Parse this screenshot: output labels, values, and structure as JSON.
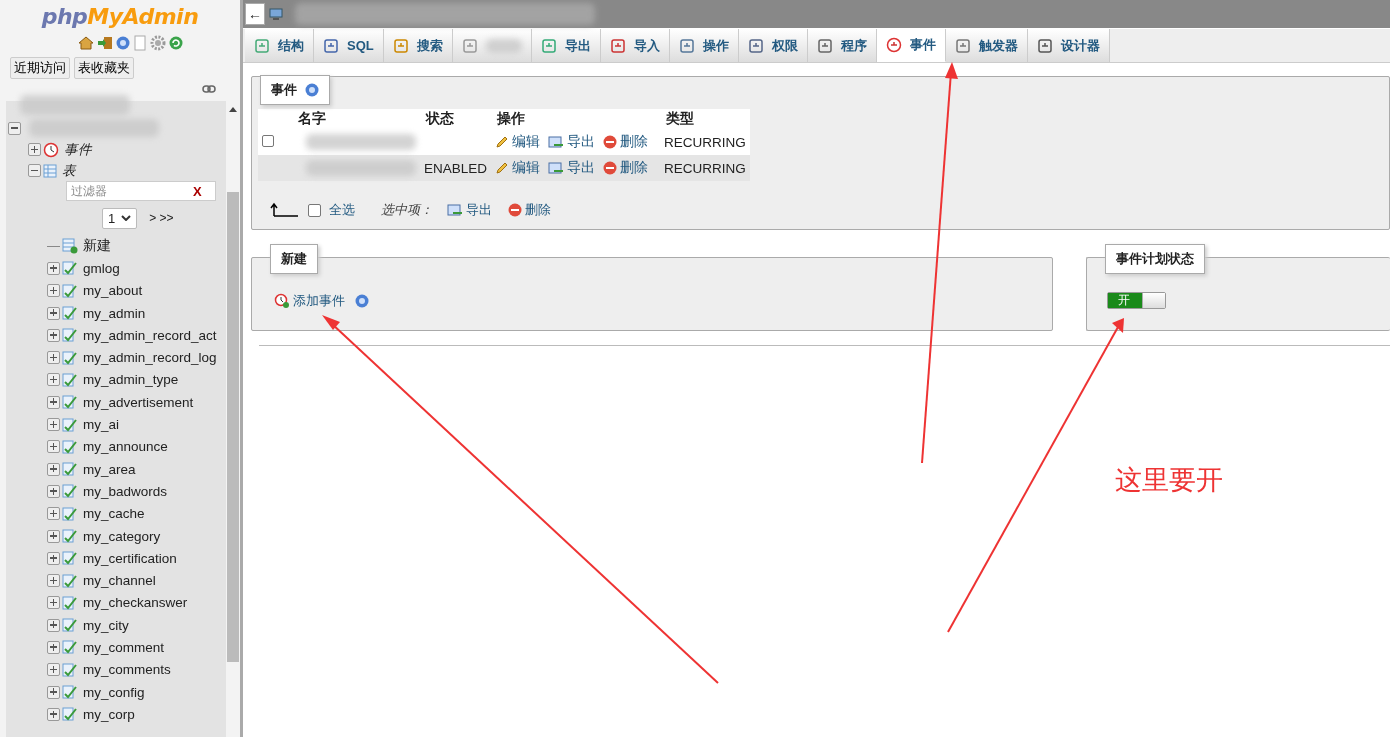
{
  "sidebar": {
    "logo": {
      "part_1": "php",
      "part_2": "MyAdmin"
    },
    "quick_buttons": [
      "近期访问",
      "表收藏夹"
    ],
    "tree": [
      {
        "expanded": true,
        "children": [
          {
            "label": "事件",
            "kind": "events",
            "expanded": false
          },
          {
            "label": "表",
            "kind": "tables",
            "expanded": true,
            "filter": {
              "placeholder": "过滤器",
              "clear": "X"
            },
            "pager": {
              "page": "1",
              "next": "> >>"
            },
            "children": [
              {
                "label": "新建",
                "kind": "new"
              },
              {
                "label": "gmlog",
                "kind": "table",
                "expanded": false
              },
              {
                "label": "my_about",
                "kind": "table",
                "expanded": false
              },
              {
                "label": "my_admin",
                "kind": "table",
                "expanded": false
              },
              {
                "label": "my_admin_record_act",
                "kind": "table",
                "expanded": false
              },
              {
                "label": "my_admin_record_log",
                "kind": "table",
                "expanded": false
              },
              {
                "label": "my_admin_type",
                "kind": "table",
                "expanded": false
              },
              {
                "label": "my_advertisement",
                "kind": "table",
                "expanded": false
              },
              {
                "label": "my_ai",
                "kind": "table",
                "expanded": false
              },
              {
                "label": "my_announce",
                "kind": "table",
                "expanded": false
              },
              {
                "label": "my_area",
                "kind": "table",
                "expanded": false
              },
              {
                "label": "my_badwords",
                "kind": "table",
                "expanded": false
              },
              {
                "label": "my_cache",
                "kind": "table",
                "expanded": false
              },
              {
                "label": "my_category",
                "kind": "table",
                "expanded": false
              },
              {
                "label": "my_certification",
                "kind": "table",
                "expanded": false
              },
              {
                "label": "my_channel",
                "kind": "table",
                "expanded": false
              },
              {
                "label": "my_checkanswer",
                "kind": "table",
                "expanded": false
              },
              {
                "label": "my_city",
                "kind": "table",
                "expanded": false
              },
              {
                "label": "my_comment",
                "kind": "table",
                "expanded": false
              },
              {
                "label": "my_comments",
                "kind": "table",
                "expanded": false
              },
              {
                "label": "my_config",
                "kind": "table",
                "expanded": false
              },
              {
                "label": "my_corp",
                "kind": "table",
                "expanded": false
              }
            ]
          }
        ]
      }
    ]
  },
  "breadcrumb": {
    "back": "←"
  },
  "tabs": [
    {
      "label": "结构",
      "kind": "structure",
      "selected": false
    },
    {
      "label": "SQL",
      "kind": "sql",
      "selected": false
    },
    {
      "label": "搜索",
      "kind": "search",
      "selected": false
    },
    {
      "kind": "query",
      "selected": false
    },
    {
      "label": "导出",
      "kind": "export",
      "selected": false
    },
    {
      "label": "导入",
      "kind": "import",
      "selected": false
    },
    {
      "label": "操作",
      "kind": "operations",
      "selected": false
    },
    {
      "label": "权限",
      "kind": "privileges",
      "selected": false
    },
    {
      "label": "程序",
      "kind": "routines",
      "selected": false
    },
    {
      "label": "事件",
      "kind": "events",
      "selected": true
    },
    {
      "label": "触发器",
      "kind": "triggers",
      "selected": false
    },
    {
      "label": "设计器",
      "kind": "designer",
      "selected": false
    }
  ],
  "events_panel": {
    "legend": "事件",
    "columns": [
      "名字",
      "状态",
      "操作",
      "类型"
    ],
    "rows": [
      {
        "checked": false,
        "actions": [
          "编辑",
          "导出",
          "删除"
        ],
        "type": "RECURRING"
      },
      {
        "status": "ENABLED",
        "actions": [
          "编辑",
          "导出",
          "删除"
        ],
        "type": "RECURRING"
      }
    ],
    "footer": {
      "select_all": "全选",
      "checked": false,
      "with_selected": "选中项：",
      "actions": [
        "导出",
        "删除"
      ]
    }
  },
  "new_panel": {
    "legend": "新建",
    "add": "添加事件"
  },
  "scheduler_panel": {
    "legend": "事件计划状态",
    "toggle": {
      "label": "开",
      "on": true
    }
  },
  "annotation": {
    "text": "这里要开"
  }
}
